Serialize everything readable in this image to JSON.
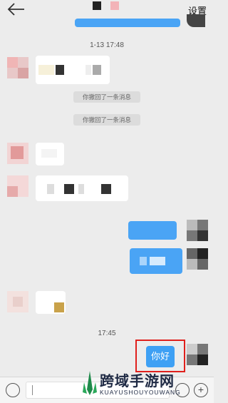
{
  "header": {
    "settings_label": "设置"
  },
  "timestamps": {
    "first": "1-13 17:48",
    "second": "17:45"
  },
  "system_messages": {
    "recall_1": "你撤回了一条消息",
    "recall_2": "你撤回了一条消息"
  },
  "last_message": {
    "text": "你好"
  },
  "watermark": {
    "title": "跨域手游网",
    "subtitle": "KUAYUSHOUYOUWANG"
  },
  "colors": {
    "accent_blue": "#4aa4f5",
    "highlight_red": "#e0201c"
  },
  "icons": {
    "back": "arrow-left-icon",
    "voice": "voice-icon",
    "emoji": "emoji-icon",
    "more": "plus-icon"
  }
}
